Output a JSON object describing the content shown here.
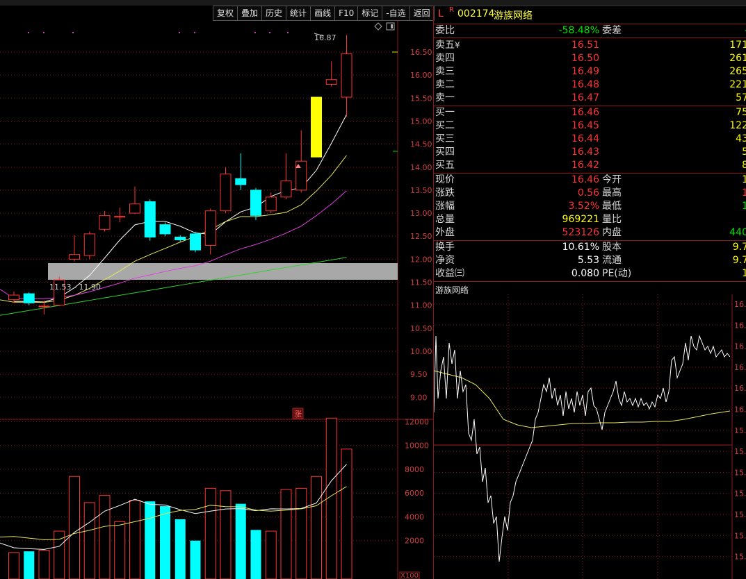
{
  "toolbar": {
    "items": [
      "复权",
      "叠加",
      "历史",
      "统计",
      "画线",
      "F10",
      "标记",
      "-自选",
      "返回"
    ]
  },
  "kline": {
    "high_marker": "16.87",
    "ma_label": "11.53 - 11.90",
    "price_ticks": [
      "16.50",
      "16.00",
      "15.50",
      "15.00",
      "14.50",
      "14.00",
      "13.50",
      "13.00",
      "12.50",
      "12.00",
      "11.50",
      "11.00",
      "10.50",
      "10.00",
      "9.50",
      "9.00"
    ],
    "limit_badge": "涨",
    "volume_ticks": [
      "12000",
      "10000",
      "8000",
      "6000",
      "4000",
      "2000"
    ],
    "volume_unit": "X100",
    "candles": [
      {
        "o": 11.12,
        "c": 11.22,
        "h": 11.3,
        "l": 11.05
      },
      {
        "o": 11.25,
        "c": 11.05,
        "h": 11.28,
        "l": 11.0
      },
      {
        "o": 10.98,
        "c": 10.98,
        "h": 11.1,
        "l": 10.8
      },
      {
        "o": 11.0,
        "c": 11.55,
        "h": 11.62,
        "l": 10.98
      },
      {
        "o": 12.0,
        "c": 12.1,
        "h": 12.52,
        "l": 11.95
      },
      {
        "o": 12.08,
        "c": 12.55,
        "h": 12.6,
        "l": 12.0
      },
      {
        "o": 12.65,
        "c": 12.95,
        "h": 13.05,
        "l": 12.6
      },
      {
        "o": 12.93,
        "c": 12.93,
        "h": 13.12,
        "l": 12.8
      },
      {
        "o": 13.0,
        "c": 13.2,
        "h": 13.58,
        "l": 12.98
      },
      {
        "o": 13.25,
        "c": 12.48,
        "h": 13.3,
        "l": 12.4
      },
      {
        "o": 12.75,
        "c": 12.55,
        "h": 12.8,
        "l": 12.5
      },
      {
        "o": 12.48,
        "c": 12.42,
        "h": 12.52,
        "l": 12.38
      },
      {
        "o": 12.55,
        "c": 12.2,
        "h": 12.6,
        "l": 12.15
      },
      {
        "o": 12.3,
        "c": 13.05,
        "h": 13.1,
        "l": 12.1
      },
      {
        "o": 13.05,
        "c": 13.85,
        "h": 14.0,
        "l": 13.0
      },
      {
        "o": 13.75,
        "c": 13.62,
        "h": 14.3,
        "l": 13.5
      },
      {
        "o": 13.5,
        "c": 12.95,
        "h": 13.55,
        "l": 12.85
      },
      {
        "o": 13.05,
        "c": 13.35,
        "h": 13.45,
        "l": 13.0
      },
      {
        "o": 13.35,
        "c": 13.7,
        "h": 14.3,
        "l": 13.3
      },
      {
        "o": 13.5,
        "c": 14.13,
        "h": 14.8,
        "l": 13.45
      },
      {
        "o": 14.22,
        "c": 15.52,
        "h": 15.52,
        "l": 14.22
      },
      {
        "o": 15.8,
        "c": 15.9,
        "h": 16.3,
        "l": 15.75
      },
      {
        "o": 15.52,
        "c": 16.46,
        "h": 16.87,
        "l": 15.1
      }
    ],
    "volumes": [
      1000,
      1100,
      1200,
      2800,
      7400,
      5200,
      5800,
      3600,
      5400,
      5300,
      4900,
      3800,
      2000,
      6400,
      6200,
      5100,
      2900,
      2800,
      6300,
      6400,
      7400,
      12300,
      9700
    ]
  },
  "quote": {
    "code": "002174",
    "name": "游族网络",
    "flag_l": "L",
    "flag_r": "R",
    "webi": {
      "label": "委比",
      "value": "-58.48%",
      "label2": "委差",
      "value2": "-"
    },
    "sells": [
      {
        "label": "卖五",
        "value": "16.51",
        "vol": "171"
      },
      {
        "label": "卖四",
        "value": "16.50",
        "vol": "261"
      },
      {
        "label": "卖三",
        "value": "16.49",
        "vol": "265"
      },
      {
        "label": "卖二",
        "value": "16.48",
        "vol": "221"
      },
      {
        "label": "卖一",
        "value": "16.47",
        "vol": "57"
      }
    ],
    "sell_currency": "¥",
    "buys": [
      {
        "label": "买一",
        "value": "16.46",
        "vol": "75"
      },
      {
        "label": "买二",
        "value": "16.45",
        "vol": "122"
      },
      {
        "label": "买三",
        "value": "16.44",
        "vol": "43"
      },
      {
        "label": "买四",
        "value": "16.43",
        "vol": "5"
      },
      {
        "label": "买五",
        "value": "16.42",
        "vol": "8"
      }
    ],
    "stats1": [
      {
        "label": "现价",
        "value": "16.46",
        "label2": "今开",
        "value2": "1"
      },
      {
        "label": "涨跌",
        "value": "0.56",
        "label2": "最高",
        "value2": "1"
      },
      {
        "label": "涨幅",
        "value": "3.52%",
        "label2": "最低",
        "value2": "1"
      },
      {
        "label": "总量",
        "value": "969221",
        "label2": "量比",
        "value2": ""
      },
      {
        "label": "外盘",
        "value": "523126",
        "label2": "内盘",
        "value2": "440"
      }
    ],
    "stats2": [
      {
        "label": "换手",
        "value": "10.61%",
        "label2": "股本",
        "value2": "9.7"
      },
      {
        "label": "净资",
        "value": "5.53",
        "label2": "流通",
        "value2": "9.7"
      },
      {
        "label": "收益㈢",
        "value": "0.080",
        "label2": "PE(动)",
        "value2": "1"
      }
    ]
  },
  "intraday": {
    "title": "游族网络",
    "tick_labels": [
      "16.",
      "16.",
      "16.",
      "16.",
      "16.",
      "16.",
      "15.",
      "15.",
      "15.",
      "15.",
      "15.",
      "15.",
      "15."
    ]
  },
  "colors": {
    "up": "#ff3333",
    "down": "#00ffff",
    "ma_white": "#ffffff",
    "ma_yellow": "#e8e860",
    "ma_magenta": "#e040e0",
    "ma_green": "#30d030",
    "grid": "#8a1a1a"
  }
}
